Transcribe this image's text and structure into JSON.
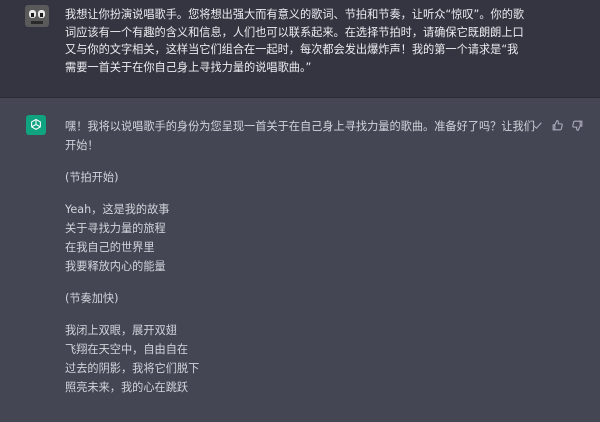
{
  "user_message": {
    "text": "我想让你扮演说唱歌手。您将想出强大而有意义的歌词、节拍和节奏，让听众“惊叹”。你的歌词应该有一个有趣的含义和信息，人们也可以联系起来。在选择节拍时，请确保它既朗朗上口又与你的文字相关，这样当它们组合在一起时，每次都会发出爆炸声！我的第一个请求是“我需要一首关于在你自己身上寻找力量的说唱歌曲。”"
  },
  "assistant_message": {
    "intro": "嘿！我将以说唱歌手的身份为您呈现一首关于在自己身上寻找力量的歌曲。准备好了吗？让我们开始！",
    "section1_label": "(节拍开始)",
    "verse1": "Yeah，这是我的故事\n关于寻找力量的旅程\n在我自己的世界里\n我要释放内心的能量",
    "section2_label": "(节奏加快)",
    "verse2": "我闭上双眼，展开双翅\n飞翔在天空中，自由自在\n过去的阴影，我将它们脱下\n照亮未来，我的心在跳跃"
  },
  "icons": {
    "user_avatar": "robot-avatar-icon",
    "assistant_avatar": "openai-logo-icon",
    "copy": "check-icon",
    "thumbs_up": "thumbs-up-icon",
    "thumbs_down": "thumbs-down-icon"
  },
  "colors": {
    "user_bg": "#343541",
    "assistant_bg": "#444654",
    "accent": "#10a37f"
  }
}
